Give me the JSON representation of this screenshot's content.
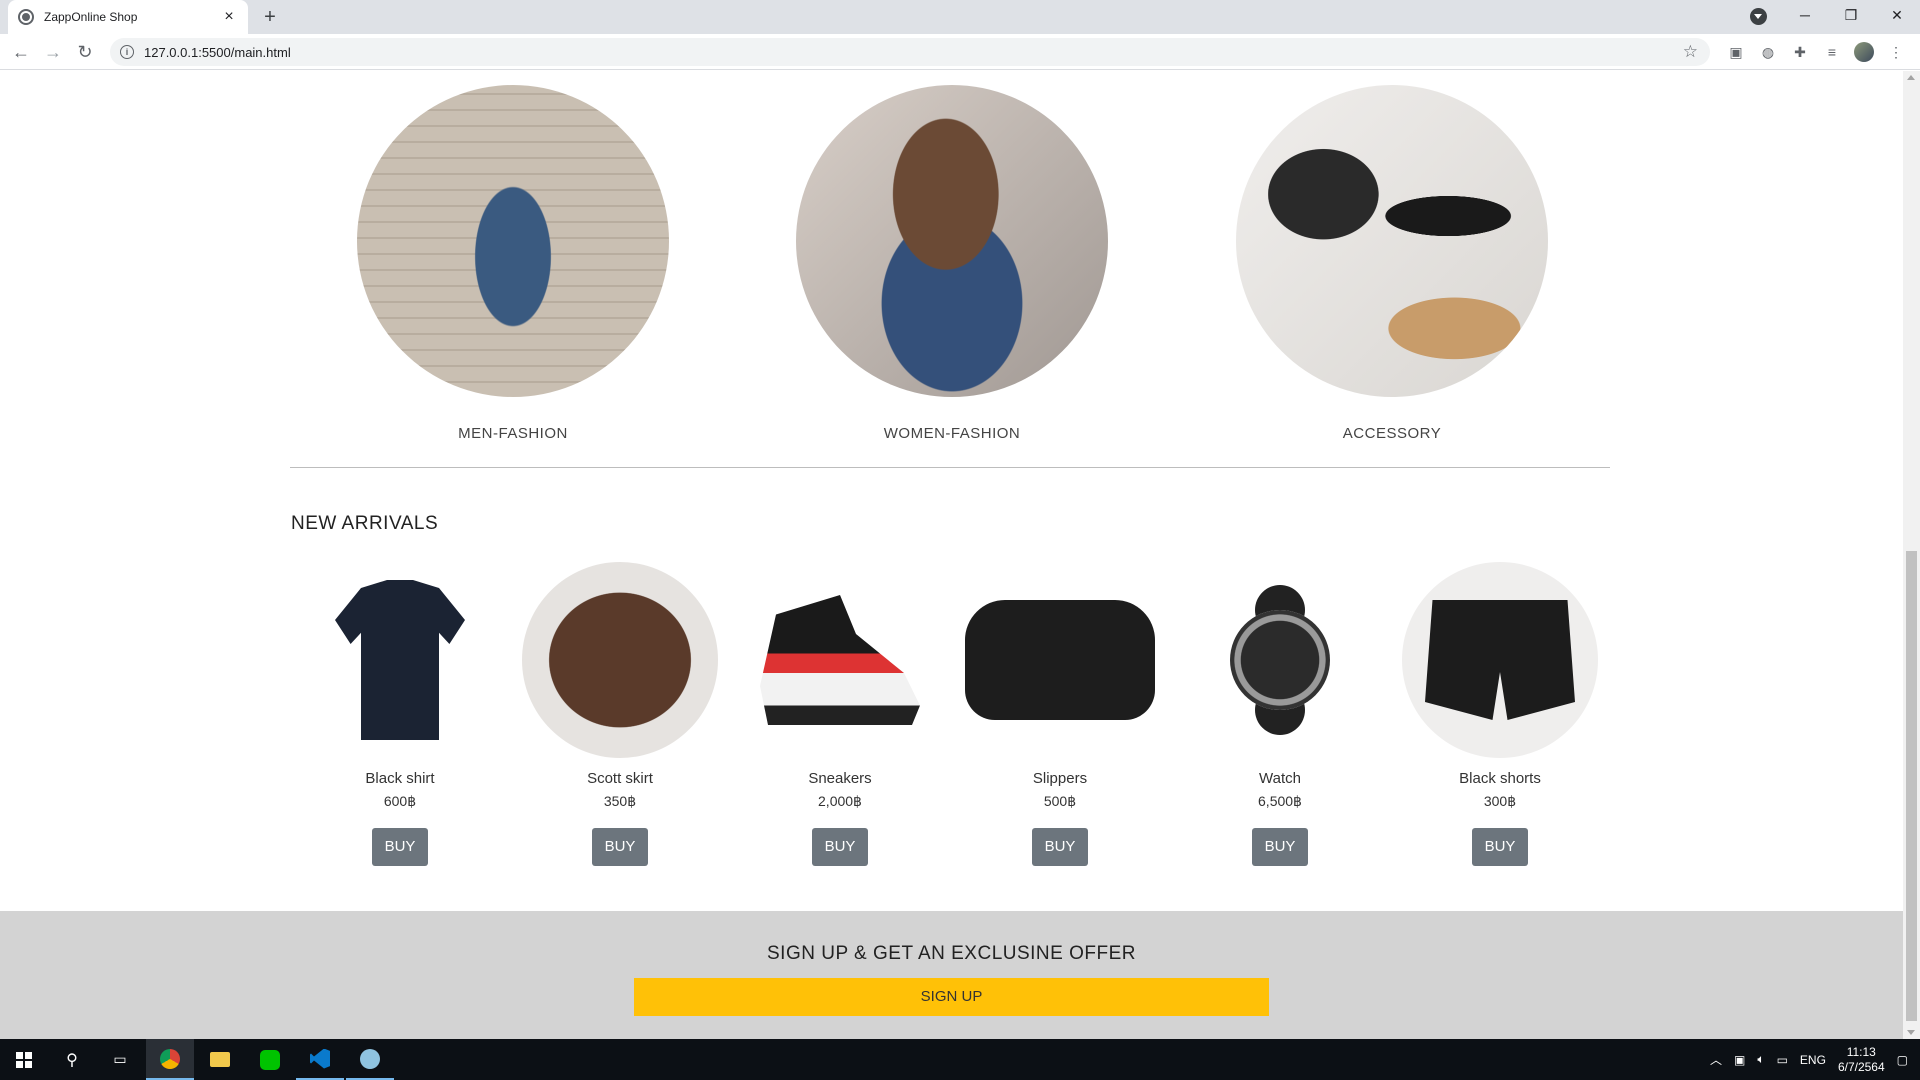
{
  "browser": {
    "tab_title": "ZappOnline Shop",
    "tab_close": "×",
    "new_tab": "+",
    "url": "127.0.0.1:5500/main.html",
    "window_controls": {
      "minimize": "─",
      "restore": "❐",
      "close": "✕"
    }
  },
  "categories": [
    {
      "label": "MEN-FASHION"
    },
    {
      "label": "WOMEN-FASHION"
    },
    {
      "label": "ACCESSORY"
    }
  ],
  "new_arrivals": {
    "title": "NEW ARRIVALS",
    "products": [
      {
        "name": "Black shirt",
        "price": "600฿",
        "button": "BUY"
      },
      {
        "name": "Scott skirt",
        "price": "350฿",
        "button": "BUY"
      },
      {
        "name": "Sneakers",
        "price": "2,000฿",
        "button": "BUY"
      },
      {
        "name": "Slippers",
        "price": "500฿",
        "button": "BUY"
      },
      {
        "name": "Watch",
        "price": "6,500฿",
        "button": "BUY"
      },
      {
        "name": "Black shorts",
        "price": "300฿",
        "button": "BUY"
      }
    ]
  },
  "signup": {
    "title": "SIGN UP & GET AN EXCLUSINE OFFER",
    "button": "SIGN UP"
  },
  "taskbar": {
    "language": "ENG",
    "time": "11:13",
    "date": "6/7/2564"
  },
  "colors": {
    "buy_button": "#6c757d",
    "signup_button": "#ffc107",
    "signup_band": "#d3d3d3"
  }
}
